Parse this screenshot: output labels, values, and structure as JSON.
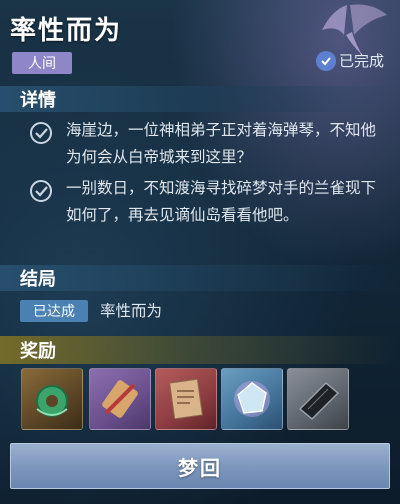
{
  "header": {
    "title": "率性而为",
    "tag": "人间",
    "status": "已完成"
  },
  "details": {
    "heading": "详情",
    "items": [
      {
        "text": "海崖边，一位神相弟子正对着海弹琴，不知他为何会从白帝城来到这里？",
        "completed": true
      },
      {
        "text": "一别数日，不知渡海寻找碎梦对手的兰雀现下如何了，再去见谪仙岛看看他吧。",
        "completed": true
      }
    ]
  },
  "ending": {
    "heading": "结局",
    "badge": "已达成",
    "text": "率性而为"
  },
  "rewards": {
    "heading": "奖励",
    "items": [
      {
        "icon": "jade-pendant-icon"
      },
      {
        "icon": "scroll-dagger-icon"
      },
      {
        "icon": "recipe-paper-icon"
      },
      {
        "icon": "ice-crystal-icon"
      },
      {
        "icon": "black-book-icon"
      }
    ]
  },
  "action": {
    "label": "梦回"
  },
  "colors": {
    "tag_bg": "#8e86c8",
    "badge_bg": "#4a80b2",
    "button_bg": "#7e97bd",
    "status_icon_bg": "#5d7fd0"
  }
}
